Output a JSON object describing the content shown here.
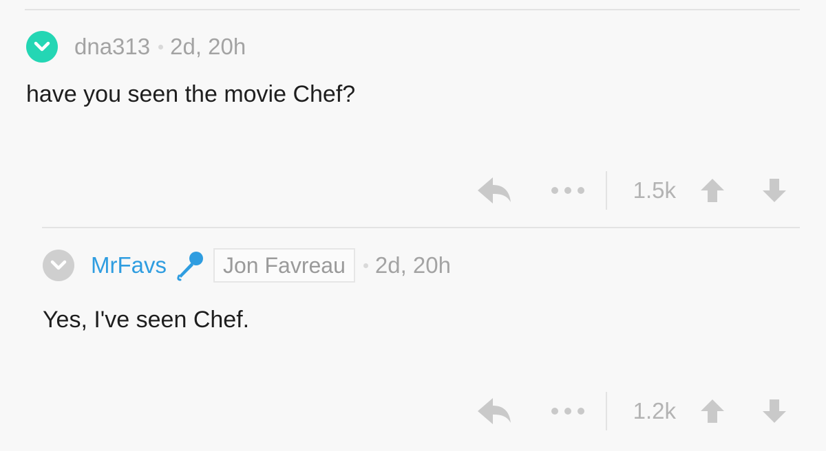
{
  "comments": [
    {
      "username": "dna313",
      "timestamp": "2d, 20h",
      "body": "have you seen the movie Chef?",
      "score": "1.5k",
      "avatar_icon": "check-chevron-icon",
      "avatar_color": "#24d6b4"
    },
    {
      "username": "MrFavs",
      "flair": "Jon Favreau",
      "badge_icon": "microphone-icon",
      "timestamp": "2d, 20h",
      "body": "Yes, I've seen Chef.",
      "score": "1.2k",
      "avatar_icon": "check-chevron-icon",
      "avatar_color": "#cfcfcf",
      "username_color": "#2f9de0"
    }
  ],
  "actions": {
    "reply_icon": "reply-arrow-icon",
    "more_icon": "more-dots-icon",
    "upvote_icon": "upvote-arrow-icon",
    "downvote_icon": "downvote-arrow-icon"
  }
}
